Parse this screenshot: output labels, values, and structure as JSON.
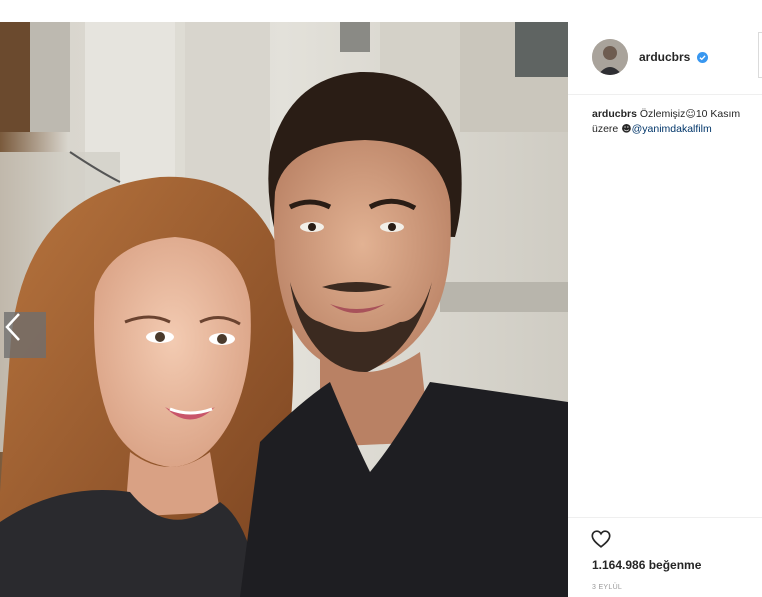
{
  "post": {
    "username": "arducbrs",
    "verified": true,
    "caption": {
      "user": "arducbrs",
      "line1": "Özlemişiz",
      "line1_b": "10 Kasım",
      "line2": "üzere ",
      "mention": "@yanimdakalfilm"
    },
    "likes": "1.164.986 beğenme",
    "date": "3 EYLÜL"
  },
  "icons": {
    "prev": "chevron-left-icon",
    "like": "heart-outline-icon",
    "verified": "verified-badge-icon"
  },
  "colors": {
    "verified": "#3897f0",
    "link": "#003569",
    "text": "#262626"
  }
}
